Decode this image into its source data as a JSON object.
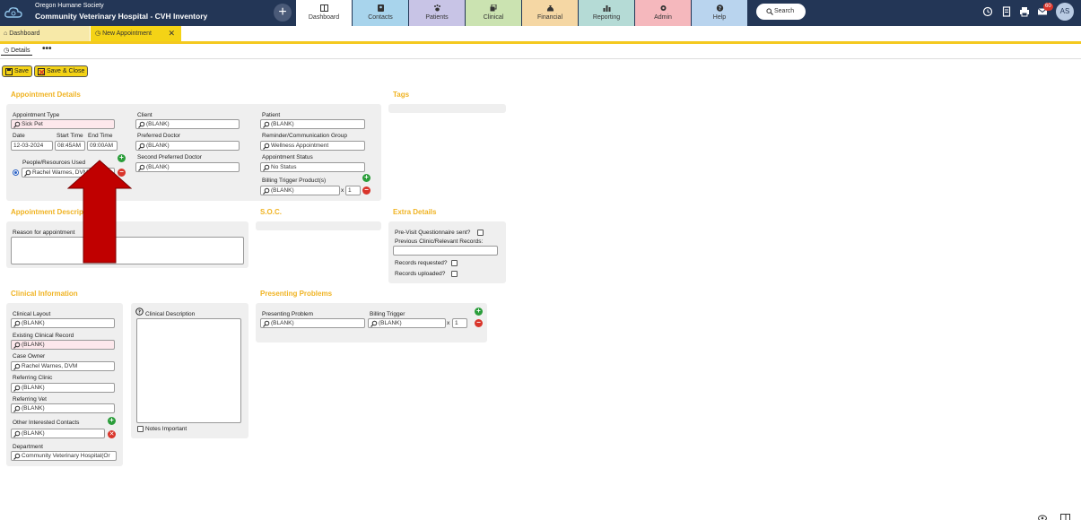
{
  "header": {
    "org_name": "Oregon Humane Society",
    "app_title": "Community Veterinary Hospital - CVH Inventory",
    "nav": [
      {
        "label": "Dashboard",
        "color": "#ffffff"
      },
      {
        "label": "Contacts",
        "color": "#a8d4ec"
      },
      {
        "label": "Patients",
        "color": "#c8c4e6"
      },
      {
        "label": "Clinical",
        "color": "#cbe3b1"
      },
      {
        "label": "Financial",
        "color": "#f5d7a4"
      },
      {
        "label": "Reporting",
        "color": "#b5dbd6"
      },
      {
        "label": "Admin",
        "color": "#f5b8bd"
      },
      {
        "label": "Help",
        "color": "#b9d4ee"
      }
    ],
    "search_label": "Search",
    "mail_count": "60",
    "user_initials": "AS"
  },
  "tabs": {
    "dashboard": "Dashboard",
    "new_appointment": "New Appointment",
    "close": "✕"
  },
  "subtabs": {
    "details": "Details",
    "more": "•••"
  },
  "toolbar": {
    "save": "Save",
    "save_close": "Save & Close"
  },
  "appointment_details": {
    "title": "Appointment Details",
    "appointment_type_label": "Appointment Type",
    "appointment_type_value": "Sick Pet",
    "date_label": "Date",
    "date_value": "12-03-2024",
    "start_time_label": "Start Time",
    "start_time_value": "08:45AM",
    "end_time_label": "End Time",
    "end_time_value": "09:00AM",
    "resources_label": "People/Resources Used",
    "resources_value": "Rachel Warnes, DVM",
    "client_label": "Client",
    "client_value": "(BLANK)",
    "preferred_doctor_label": "Preferred Doctor",
    "preferred_doctor_value": "(BLANK)",
    "second_doctor_label": "Second Preferred Doctor",
    "second_doctor_value": "(BLANK)",
    "patient_label": "Patient",
    "patient_value": "(BLANK)",
    "reminder_label": "Reminder/Communication Group",
    "reminder_value": "Wellness Appointment",
    "status_label": "Appointment Status",
    "status_value": "No Status",
    "billing_label": "Billing Trigger Product(s)",
    "billing_value": "(BLANK)",
    "billing_qty": "1",
    "x_sign": "x"
  },
  "tags": {
    "title": "Tags"
  },
  "appointment_description": {
    "title": "Appointment Description",
    "reason_label": "Reason for appointment"
  },
  "soc": {
    "title": "S.O.C."
  },
  "extra_details": {
    "title": "Extra Details",
    "questionnaire_label": "Pre-Visit Questionnaire sent?",
    "previous_clinic_label": "Previous Clinic/Relevant Records:",
    "records_requested_label": "Records requested?",
    "records_uploaded_label": "Records uploaded?"
  },
  "clinical_information": {
    "title": "Clinical Information",
    "layout_label": "Clinical Layout",
    "layout_value": "(BLANK)",
    "existing_record_label": "Existing Clinical Record",
    "existing_record_value": "(BLANK)",
    "case_owner_label": "Case Owner",
    "case_owner_value": "Rachel Warnes, DVM",
    "referring_clinic_label": "Referring Clinic",
    "referring_clinic_value": "(BLANK)",
    "referring_vet_label": "Referring Vet",
    "referring_vet_value": "(BLANK)",
    "other_contacts_label": "Other Interested Contacts",
    "other_contacts_value": "(BLANK)",
    "department_label": "Department",
    "department_value": "Community Veterinary Hospital(Or",
    "description_label": "Clinical Description",
    "notes_important_label": "Notes Important"
  },
  "presenting_problems": {
    "title": "Presenting Problems",
    "problem_label": "Presenting Problem",
    "problem_value": "(BLANK)",
    "trigger_label": "Billing Trigger",
    "trigger_value": "(BLANK)",
    "qty": "1",
    "x_sign": "x"
  },
  "colors": {
    "accent": "#f4d316",
    "section_title": "#f0b322",
    "header_bg": "#233656",
    "arrow": "#c00000"
  }
}
